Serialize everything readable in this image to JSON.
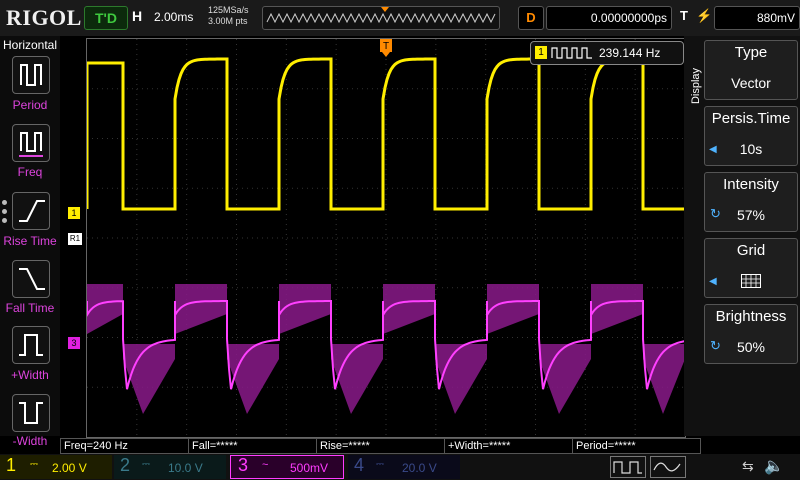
{
  "top": {
    "brand": "RIGOL",
    "run_state": "T'D",
    "horizontal_label": "H",
    "timebase": "2.00ms",
    "sample_rate": "125MSa/s",
    "memory_depth": "3.00M pts",
    "delay_label": "D",
    "delay_value": "0.00000000ps",
    "trigger_label": "T",
    "trigger_level": "880mV"
  },
  "left_menu": {
    "title": "Horizontal",
    "items": [
      {
        "label": "Period",
        "icon": "period-icon"
      },
      {
        "label": "Freq",
        "icon": "freq-icon"
      },
      {
        "label": "Rise Time",
        "icon": "rise-time-icon"
      },
      {
        "label": "Fall Time",
        "icon": "fall-time-icon"
      },
      {
        "label": "+Width",
        "icon": "pos-width-icon"
      },
      {
        "label": "-Width",
        "icon": "neg-width-icon"
      }
    ]
  },
  "screen": {
    "freq_readout": "239.144 Hz",
    "marker_ch1": "1",
    "marker_ch3": "3",
    "marker_r1": "R1"
  },
  "right_menu": {
    "tab": "Display",
    "items": [
      {
        "title": "Type",
        "value": "Vector"
      },
      {
        "title": "Persis.Time",
        "value": "10s"
      },
      {
        "title": "Intensity",
        "value": "57%"
      },
      {
        "title": "Grid",
        "value": ""
      },
      {
        "title": "Brightness",
        "value": "50%"
      }
    ]
  },
  "measurements": [
    "Freq=240 Hz",
    "Fall=*****",
    "Rise=*****",
    "+Width=*****",
    "Period=*****"
  ],
  "channels": [
    {
      "num": "1",
      "scale": "2.00 V",
      "color": "#ffee00",
      "active": true
    },
    {
      "num": "2",
      "scale": "10.0 V",
      "color": "#00c0ff",
      "active": false
    },
    {
      "num": "3",
      "scale": "500mV",
      "color": "#ff3cff",
      "active": true
    },
    {
      "num": "4",
      "scale": "20.0 V",
      "color": "#3060ff",
      "active": false
    }
  ],
  "colors": {
    "ch1": "#ffee00",
    "ch3": "#e020e0",
    "delay": "#ff8a00"
  }
}
